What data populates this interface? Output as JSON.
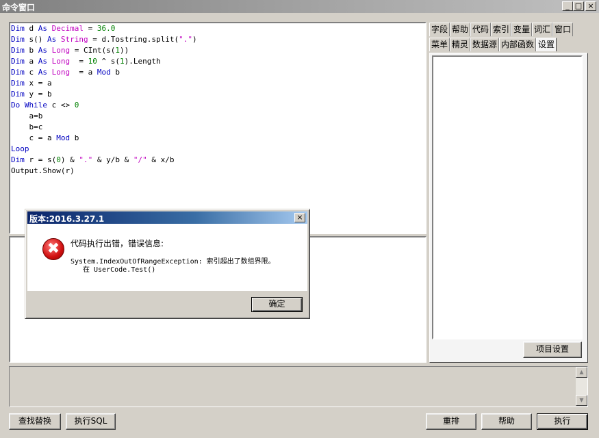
{
  "window": {
    "title": "命令窗口",
    "minimize": "_",
    "maximize": "□",
    "close": "×"
  },
  "code_lines": [
    [
      {
        "t": "Dim ",
        "c": "kw"
      },
      {
        "t": "d ",
        "c": ""
      },
      {
        "t": "As ",
        "c": "kw"
      },
      {
        "t": "Decimal",
        "c": "ty"
      },
      {
        "t": " = ",
        "c": ""
      },
      {
        "t": "36.0",
        "c": "num"
      }
    ],
    [
      {
        "t": "Dim ",
        "c": "kw"
      },
      {
        "t": "s() ",
        "c": ""
      },
      {
        "t": "As ",
        "c": "kw"
      },
      {
        "t": "String",
        "c": "ty"
      },
      {
        "t": " = d.Tostring.split(",
        "c": ""
      },
      {
        "t": "\".\"",
        "c": "str"
      },
      {
        "t": ")",
        "c": ""
      }
    ],
    [
      {
        "t": "Dim ",
        "c": "kw"
      },
      {
        "t": "b ",
        "c": ""
      },
      {
        "t": "As ",
        "c": "kw"
      },
      {
        "t": "Long",
        "c": "ty"
      },
      {
        "t": " = CInt(s(",
        "c": ""
      },
      {
        "t": "1",
        "c": "num"
      },
      {
        "t": "))",
        "c": ""
      }
    ],
    [
      {
        "t": "Dim ",
        "c": "kw"
      },
      {
        "t": "a ",
        "c": ""
      },
      {
        "t": "As ",
        "c": "kw"
      },
      {
        "t": "Long",
        "c": "ty"
      },
      {
        "t": "  = ",
        "c": ""
      },
      {
        "t": "10",
        "c": "num"
      },
      {
        "t": " ^ s(",
        "c": ""
      },
      {
        "t": "1",
        "c": "num"
      },
      {
        "t": ").Length",
        "c": ""
      }
    ],
    [
      {
        "t": "Dim ",
        "c": "kw"
      },
      {
        "t": "c ",
        "c": ""
      },
      {
        "t": "As ",
        "c": "kw"
      },
      {
        "t": "Long",
        "c": "ty"
      },
      {
        "t": "  = a ",
        "c": ""
      },
      {
        "t": "Mod",
        "c": "kw"
      },
      {
        "t": " b",
        "c": ""
      }
    ],
    [
      {
        "t": "Dim ",
        "c": "kw"
      },
      {
        "t": "x = a",
        "c": ""
      }
    ],
    [
      {
        "t": "Dim ",
        "c": "kw"
      },
      {
        "t": "y = b",
        "c": ""
      }
    ],
    [
      {
        "t": "Do While",
        "c": "kw"
      },
      {
        "t": " c <> ",
        "c": ""
      },
      {
        "t": "0",
        "c": "num"
      }
    ],
    [
      {
        "t": "    a=b",
        "c": ""
      }
    ],
    [
      {
        "t": "    b=c",
        "c": ""
      }
    ],
    [
      {
        "t": "    c = a ",
        "c": ""
      },
      {
        "t": "Mod",
        "c": "kw"
      },
      {
        "t": " b",
        "c": ""
      }
    ],
    [
      {
        "t": "Loop",
        "c": "kw"
      }
    ],
    [
      {
        "t": "Dim ",
        "c": "kw"
      },
      {
        "t": "r = s(",
        "c": ""
      },
      {
        "t": "0",
        "c": "num"
      },
      {
        "t": ") & ",
        "c": ""
      },
      {
        "t": "\".\"",
        "c": "str"
      },
      {
        "t": " & y/b & ",
        "c": ""
      },
      {
        "t": "\"/\"",
        "c": "str"
      },
      {
        "t": " & x/b",
        "c": ""
      }
    ],
    [
      {
        "t": "Output.Show(r)",
        "c": ""
      }
    ]
  ],
  "tabs_row1": [
    "字段",
    "帮助",
    "代码",
    "索引",
    "变量",
    "词汇",
    "窗口"
  ],
  "tabs_row2": [
    "菜单",
    "精灵",
    "数据源",
    "内部函数",
    "设置"
  ],
  "active_tab": "设置",
  "project_settings_button": "项目设置",
  "bottom_buttons": {
    "find_replace": "查找替换",
    "run_sql": "执行SQL",
    "rearrange": "重排",
    "help": "帮助",
    "execute": "执行"
  },
  "dialog": {
    "title": "版本:2016.3.27.1",
    "close": "×",
    "icon": "error-icon",
    "icon_glyph": "✖",
    "message_title": "代码执行出错，错误信息:",
    "message_detail": "System.IndexOutOfRangeException: 索引超出了数组界限。",
    "message_stack": "在 UserCode.Test()",
    "ok_button": "确定"
  },
  "colors": {
    "keyword": "#0000c0",
    "type": "#c000c0",
    "number": "#008000",
    "dialog_title": "#0a246a"
  }
}
